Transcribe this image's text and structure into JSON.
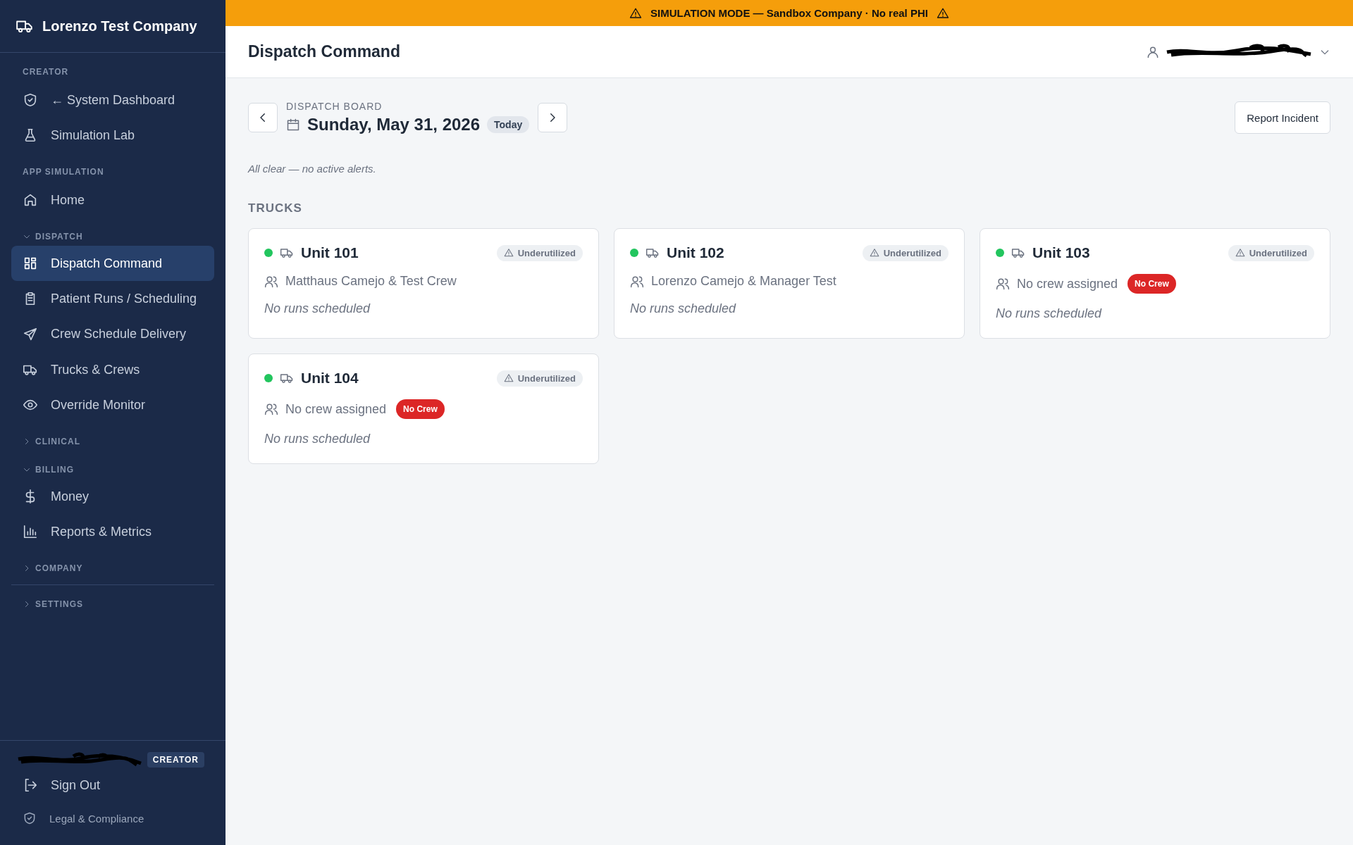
{
  "banner": {
    "text": "SIMULATION MODE — Sandbox Company · No real PHI"
  },
  "sidebar": {
    "company": "Lorenzo Test Company",
    "nav": [
      {
        "kind": "label",
        "label": "CREATOR"
      },
      {
        "kind": "link",
        "label": "← System Dashboard",
        "selected": false
      },
      {
        "kind": "link",
        "label": "Simulation Lab",
        "selected": false
      },
      {
        "kind": "label",
        "label": "APP SIMULATION"
      },
      {
        "kind": "link",
        "label": "Home",
        "selected": false
      },
      {
        "kind": "group",
        "label": "DISPATCH",
        "expanded": true
      },
      {
        "kind": "link",
        "label": "Dispatch Command",
        "selected": true
      },
      {
        "kind": "link",
        "label": "Patient Runs / Scheduling",
        "selected": false
      },
      {
        "kind": "link",
        "label": "Crew Schedule Delivery",
        "selected": false
      },
      {
        "kind": "link",
        "label": "Trucks & Crews",
        "selected": false
      },
      {
        "kind": "link",
        "label": "Override Monitor",
        "selected": false
      },
      {
        "kind": "group",
        "label": "CLINICAL",
        "expanded": false
      },
      {
        "kind": "group",
        "label": "BILLING",
        "expanded": true
      },
      {
        "kind": "link",
        "label": "Money",
        "selected": false
      },
      {
        "kind": "link",
        "label": "Reports & Metrics",
        "selected": false
      },
      {
        "kind": "group",
        "label": "COMPANY",
        "expanded": false
      },
      {
        "kind": "divider"
      },
      {
        "kind": "group",
        "label": "SETTINGS",
        "expanded": false
      }
    ],
    "role_badge": "CREATOR",
    "sign_out": "Sign Out",
    "legal": "Legal & Compliance"
  },
  "header": {
    "title": "Dispatch Command"
  },
  "board": {
    "label": "DISPATCH BOARD",
    "date": "Sunday, May 31, 2026",
    "today": "Today",
    "report_button": "Report Incident",
    "alerts": "All clear — no active alerts."
  },
  "trucks": {
    "heading": "TRUCKS",
    "items": [
      {
        "name": "Unit 101",
        "color": "#22c55e",
        "flag": "Underutilized",
        "crew": "Matthaus Camejo & Test Crew",
        "runs": "No runs scheduled"
      },
      {
        "name": "Unit 102",
        "color": "#22c55e",
        "flag": "Underutilized",
        "crew": "Lorenzo Camejo & Manager Test",
        "runs": "No runs scheduled"
      },
      {
        "name": "Unit 103",
        "color": "#22c55e",
        "flag": "Underutilized",
        "crew": "No crew assigned",
        "badge": "No Crew",
        "runs": "No runs scheduled"
      },
      {
        "name": "Unit 104",
        "color": "#22c55e",
        "flag": "Underutilized",
        "crew": "No crew assigned",
        "badge": "No Crew",
        "runs": "No runs scheduled"
      }
    ]
  }
}
